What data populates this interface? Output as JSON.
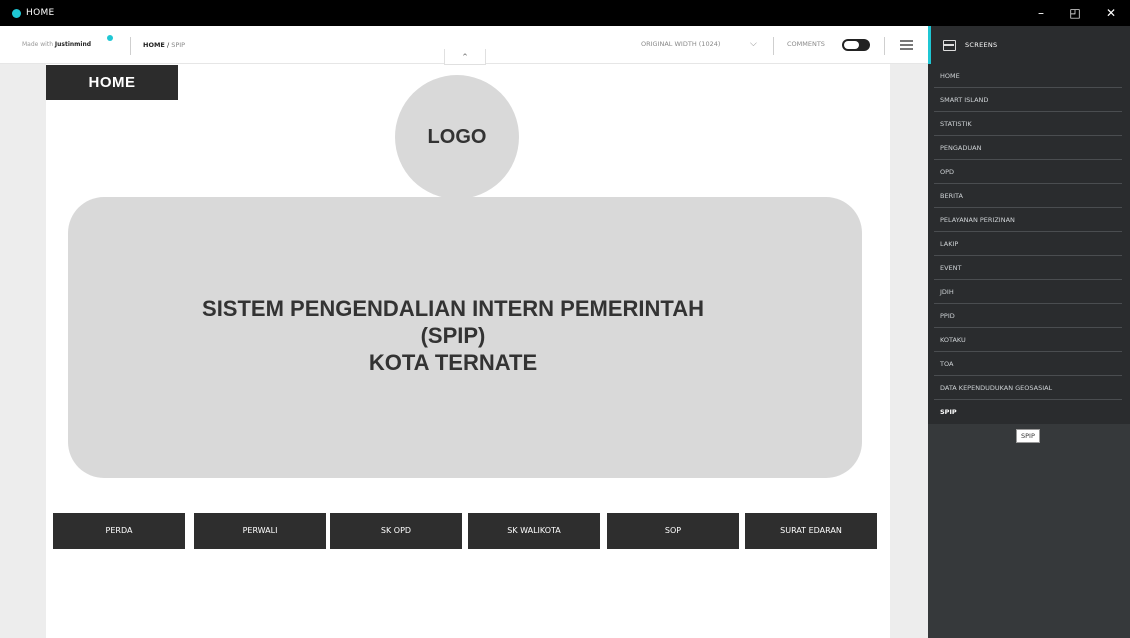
{
  "window": {
    "title": "HOME",
    "minimize": "–",
    "restore": "◰",
    "close": "✕"
  },
  "toolbar": {
    "made_with_prefix": "Made with ",
    "made_with_brand": "Justinmind",
    "breadcrumb_root": "HOME",
    "breadcrumb_sep": " / ",
    "breadcrumb_current": "SPIP",
    "width_select": "ORIGINAL WIDTH (1024)",
    "width_chevron": "⌵",
    "comments_label": "COMMENTS",
    "collapse_icon": "⌃"
  },
  "canvas": {
    "home_label": "HOME",
    "logo": "LOGO",
    "hero": {
      "line1": "SISTEM PENGENDALIAN INTERN PEMERINTAH",
      "line2": "(SPIP)",
      "line3": "KOTA TERNATE"
    },
    "buttons": [
      "PERDA",
      "PERWALI",
      "SK OPD",
      "SK WALIKOTA",
      "SOP",
      "SURAT EDARAN"
    ]
  },
  "screens_panel": {
    "title": "SCREENS",
    "items": [
      "HOME",
      "SMART ISLAND",
      "STATISTIK",
      "PENGADUAN",
      "OPD",
      "BERITA",
      "PELAYANAN PERIZINAN",
      "LAKIP",
      "EVENT",
      "JDIH",
      "PPID",
      "KOTAKU",
      "TOA",
      "DATA KEPENDUDUKAN GEOSASIAL",
      "SPIP"
    ],
    "active_index": 14,
    "tooltip": "SPIP"
  },
  "colors": {
    "accent": "#1fc7d4",
    "dark_button": "#2e2e2e",
    "placeholder_gray": "#d9d9d9",
    "panel_bg": "#36393b"
  }
}
